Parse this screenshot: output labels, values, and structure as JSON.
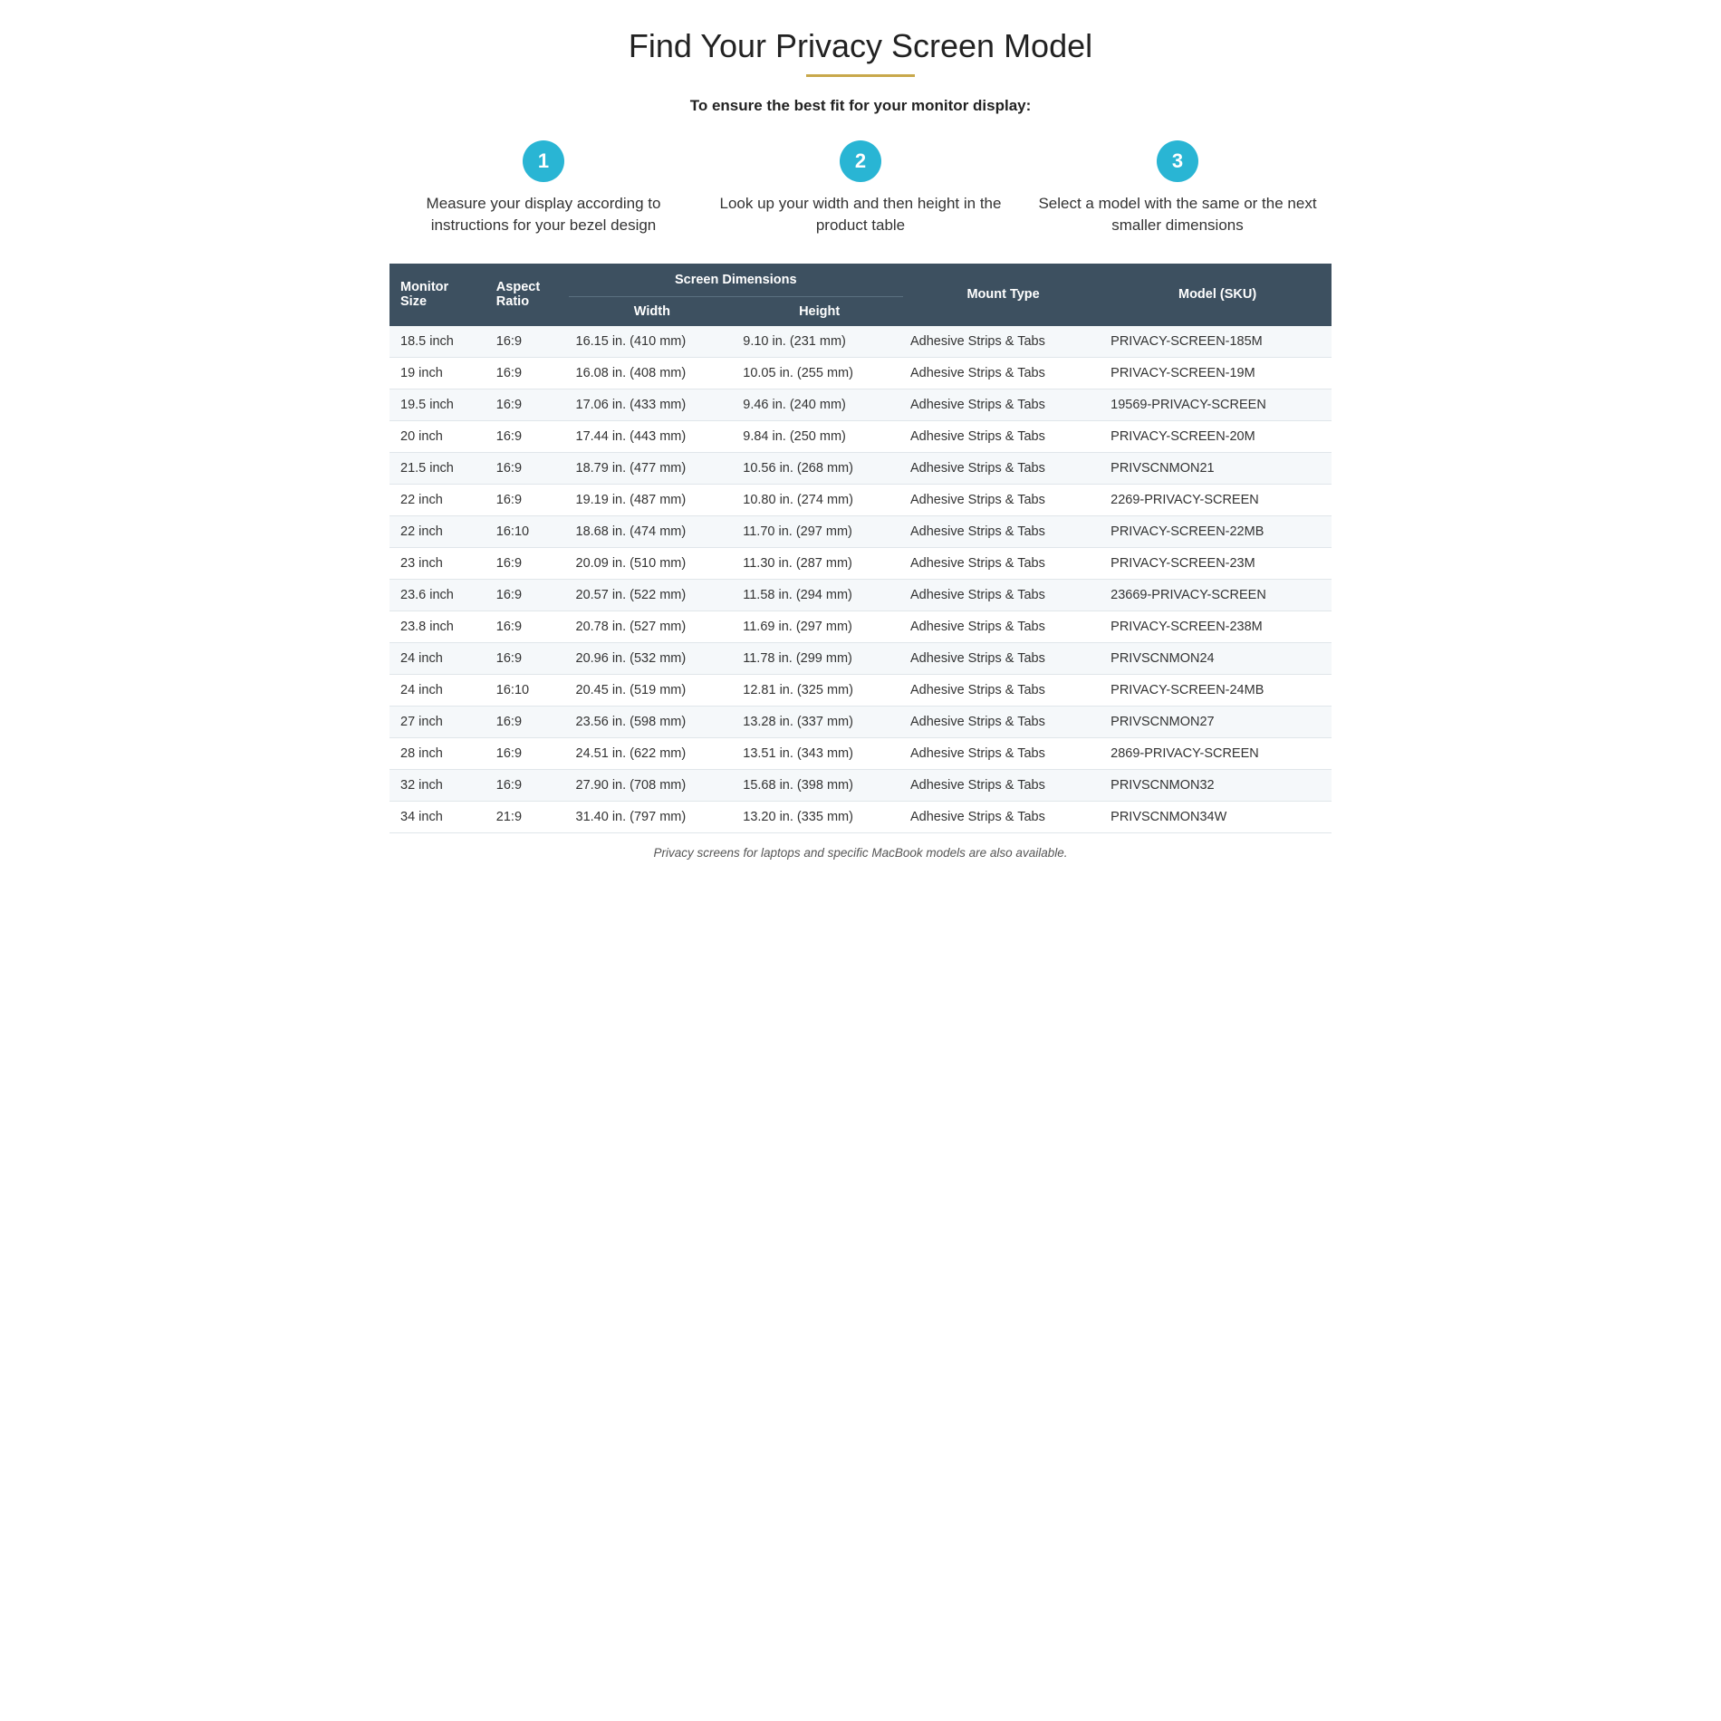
{
  "title": "Find Your Privacy Screen Model",
  "subtitle": "To ensure the best fit for your monitor display:",
  "steps": [
    {
      "number": "1",
      "text": "Measure your display according to instructions for your bezel design"
    },
    {
      "number": "2",
      "text": "Look up your width and then height in the product table"
    },
    {
      "number": "3",
      "text": "Select a model with the same or the next smaller dimensions"
    }
  ],
  "table": {
    "col_headers_top": [
      "Monitor Size",
      "Aspect Ratio",
      "Screen Dimensions",
      "",
      "Mount Type",
      "Model (SKU)"
    ],
    "col_headers_sub": [
      "",
      "",
      "Width",
      "Height",
      "",
      ""
    ],
    "rows": [
      [
        "18.5 inch",
        "16:9",
        "16.15 in. (410 mm)",
        "9.10 in. (231 mm)",
        "Adhesive Strips & Tabs",
        "PRIVACY-SCREEN-185M"
      ],
      [
        "19 inch",
        "16:9",
        "16.08 in. (408 mm)",
        "10.05 in. (255 mm)",
        "Adhesive Strips & Tabs",
        "PRIVACY-SCREEN-19M"
      ],
      [
        "19.5 inch",
        "16:9",
        "17.06 in. (433 mm)",
        "9.46 in. (240 mm)",
        "Adhesive Strips & Tabs",
        "19569-PRIVACY-SCREEN"
      ],
      [
        "20 inch",
        "16:9",
        "17.44 in. (443 mm)",
        "9.84 in. (250 mm)",
        "Adhesive Strips & Tabs",
        "PRIVACY-SCREEN-20M"
      ],
      [
        "21.5 inch",
        "16:9",
        "18.79 in. (477 mm)",
        "10.56 in. (268 mm)",
        "Adhesive Strips & Tabs",
        "PRIVSCNMON21"
      ],
      [
        "22 inch",
        "16:9",
        "19.19 in. (487 mm)",
        "10.80 in. (274 mm)",
        "Adhesive Strips & Tabs",
        "2269-PRIVACY-SCREEN"
      ],
      [
        "22 inch",
        "16:10",
        "18.68 in. (474 mm)",
        "11.70 in. (297 mm)",
        "Adhesive Strips & Tabs",
        "PRIVACY-SCREEN-22MB"
      ],
      [
        "23 inch",
        "16:9",
        "20.09 in. (510 mm)",
        "11.30 in. (287 mm)",
        "Adhesive Strips & Tabs",
        "PRIVACY-SCREEN-23M"
      ],
      [
        "23.6 inch",
        "16:9",
        "20.57 in. (522 mm)",
        "11.58 in. (294 mm)",
        "Adhesive Strips & Tabs",
        "23669-PRIVACY-SCREEN"
      ],
      [
        "23.8 inch",
        "16:9",
        "20.78 in. (527 mm)",
        "11.69 in. (297 mm)",
        "Adhesive Strips & Tabs",
        "PRIVACY-SCREEN-238M"
      ],
      [
        "24 inch",
        "16:9",
        "20.96 in. (532 mm)",
        "11.78 in. (299 mm)",
        "Adhesive Strips & Tabs",
        "PRIVSCNMON24"
      ],
      [
        "24 inch",
        "16:10",
        "20.45 in. (519 mm)",
        "12.81 in. (325 mm)",
        "Adhesive Strips & Tabs",
        "PRIVACY-SCREEN-24MB"
      ],
      [
        "27 inch",
        "16:9",
        "23.56 in. (598 mm)",
        "13.28 in. (337 mm)",
        "Adhesive Strips & Tabs",
        "PRIVSCNMON27"
      ],
      [
        "28 inch",
        "16:9",
        "24.51 in. (622 mm)",
        "13.51 in. (343 mm)",
        "Adhesive Strips & Tabs",
        "2869-PRIVACY-SCREEN"
      ],
      [
        "32 inch",
        "16:9",
        "27.90 in. (708 mm)",
        "15.68 in. (398 mm)",
        "Adhesive Strips & Tabs",
        "PRIVSCNMON32"
      ],
      [
        "34 inch",
        "21:9",
        "31.40 in. (797 mm)",
        "13.20 in. (335 mm)",
        "Adhesive Strips & Tabs",
        "PRIVSCNMON34W"
      ]
    ]
  },
  "footer": "Privacy screens for laptops and specific MacBook models are also available."
}
